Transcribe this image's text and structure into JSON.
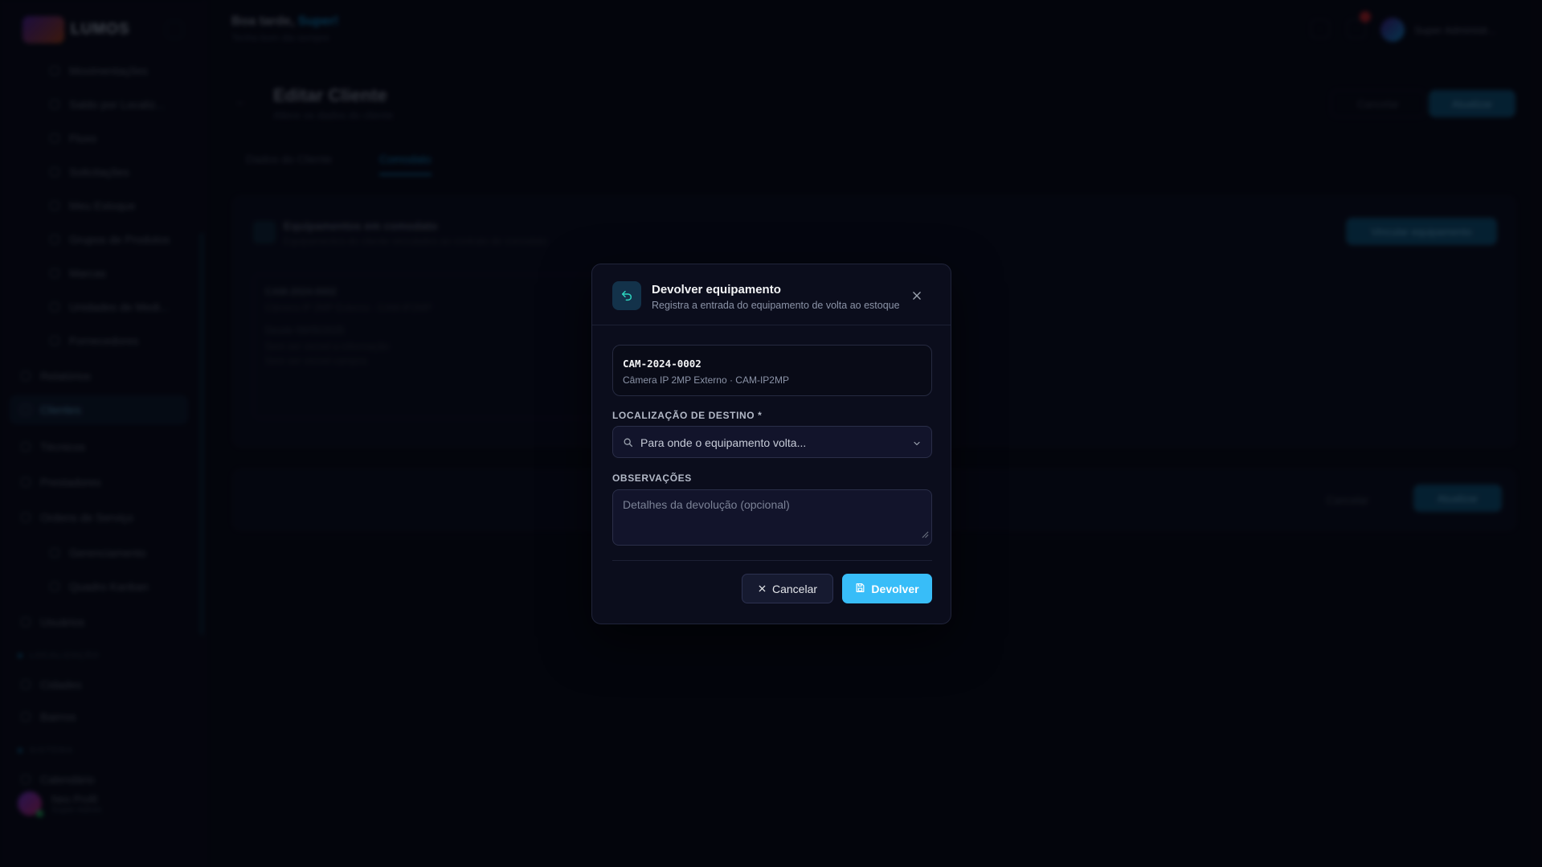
{
  "app": {
    "brand": "LUMOS",
    "greeting_prefix": "Boa tarde,",
    "greeting_name": "Super!",
    "greeting_sub": "Tenha bom dia sempre",
    "top_user": "Super Administr..."
  },
  "sidebar": {
    "items": [
      {
        "label": "Movimentações"
      },
      {
        "label": "Saldo por Localiz..."
      },
      {
        "label": "Fluxo"
      },
      {
        "label": "Solicitações"
      },
      {
        "label": "Meu Estoque"
      },
      {
        "label": "Grupos de Produtos"
      },
      {
        "label": "Marcas"
      },
      {
        "label": "Unidades de Medi..."
      },
      {
        "label": "Fornecedores"
      },
      {
        "label": "Relatórios"
      },
      {
        "label": "Clientes"
      },
      {
        "label": "Técnicos"
      },
      {
        "label": "Prestadores"
      },
      {
        "label": "Ordens de Serviço"
      },
      {
        "label": "Gerenciamento"
      },
      {
        "label": "Quadro Kanban"
      },
      {
        "label": "Usuários"
      },
      {
        "label": "Cidades"
      },
      {
        "label": "Bairros"
      },
      {
        "label": "Calendário"
      }
    ],
    "section_1": "LOCALIZAÇÃO",
    "section_2": "SISTEMA",
    "user_name": "Neo Profil",
    "user_role": "Super Admin"
  },
  "page": {
    "title": "Editar Cliente",
    "subtitle": "Altere os dados do cliente",
    "cancel_label": "Cancelar",
    "save_label": "Atualizar",
    "tabs": [
      {
        "label": "Dados do Cliente"
      },
      {
        "label": "Comodato"
      }
    ],
    "card_title": "Equipamentos em comodato",
    "card_subtitle": "Equipamentos do cliente vinculados ao contrato de comodato",
    "card_button": "Vincular equipamento",
    "item_code": "CAM-2024-0002",
    "item_desc": "Câmera IP 2MP Externo · CAM-IP2MP",
    "item_date": "Desde 09/05/2025",
    "item_line_1": "Sem ser visível a informação",
    "item_line_2": "Sem ser visível campos"
  },
  "modal": {
    "title": "Devolver equipamento",
    "subtitle": "Registra a entrada do equipamento de volta ao estoque",
    "equipment_code": "CAM-2024-0002",
    "equipment_description": "Câmera IP 2MP Externo · CAM-IP2MP",
    "destination_label": "LOCALIZAÇÃO DE DESTINO *",
    "destination_placeholder": "Para onde o equipamento volta...",
    "notes_label": "OBSERVAÇÕES",
    "notes_placeholder": "Detalhes da devolução (opcional)",
    "cancel_label": "Cancelar",
    "submit_label": "Devolver"
  },
  "colors": {
    "accent": "#38bdf8",
    "background": "#05060e",
    "modal_bg": "#0b0d1c",
    "icon_bg": "#13324a"
  },
  "icons": {
    "modal_header": "undo-arrow-icon",
    "close": "close-icon",
    "search": "search-icon",
    "dropdown": "chevron-down-icon",
    "cancel": "x-icon",
    "submit": "save-icon"
  }
}
